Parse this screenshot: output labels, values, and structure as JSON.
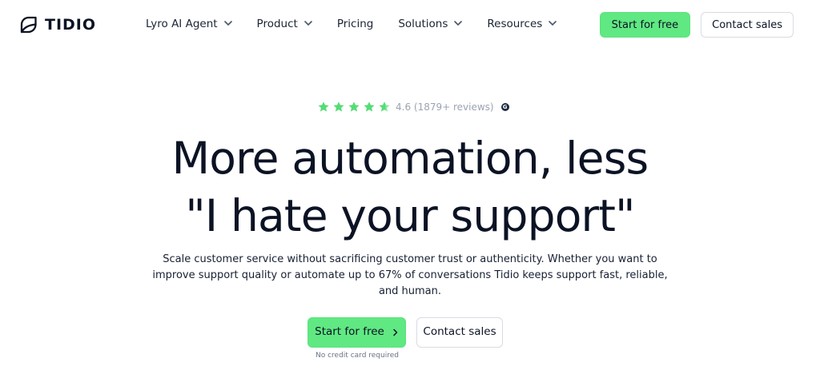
{
  "brand": {
    "name": "TIDIO",
    "logo_icon": "tidio-logo-icon"
  },
  "nav": {
    "items": [
      {
        "label": "Lyro AI Agent",
        "has_dropdown": true
      },
      {
        "label": "Product",
        "has_dropdown": true
      },
      {
        "label": "Pricing",
        "has_dropdown": false
      },
      {
        "label": "Solutions",
        "has_dropdown": true
      },
      {
        "label": "Resources",
        "has_dropdown": true
      }
    ]
  },
  "header": {
    "start_free_label": "Start for free",
    "contact_sales_label": "Contact sales"
  },
  "hero": {
    "rating": {
      "stars_filled": 4.6,
      "stars_max": 5,
      "text": "4.6 (1879+ reviews)",
      "badge": "G"
    },
    "headline": {
      "line1": "More automation, less",
      "line2": "\"I hate your support\""
    },
    "subtitle": "Scale customer service without sacrificing customer trust or authenticity. Whether you want to improve support quality or automate up to 67% of conversations Tidio keeps support fast, reliable, and human.",
    "start_free_label": "Start for free",
    "contact_sales_label": "Contact sales",
    "no_card_label": "No credit card required"
  },
  "colors": {
    "accent": "#60e882",
    "text": "#0b1324",
    "muted": "#9aa4b2",
    "border": "#d7dce3"
  },
  "icons": {
    "star": "star-icon",
    "partial_star": "partial-star-icon",
    "chevron_down": "chevron-down-icon",
    "chevron_right": "chevron-right-icon",
    "review_badge": "g2-icon"
  }
}
